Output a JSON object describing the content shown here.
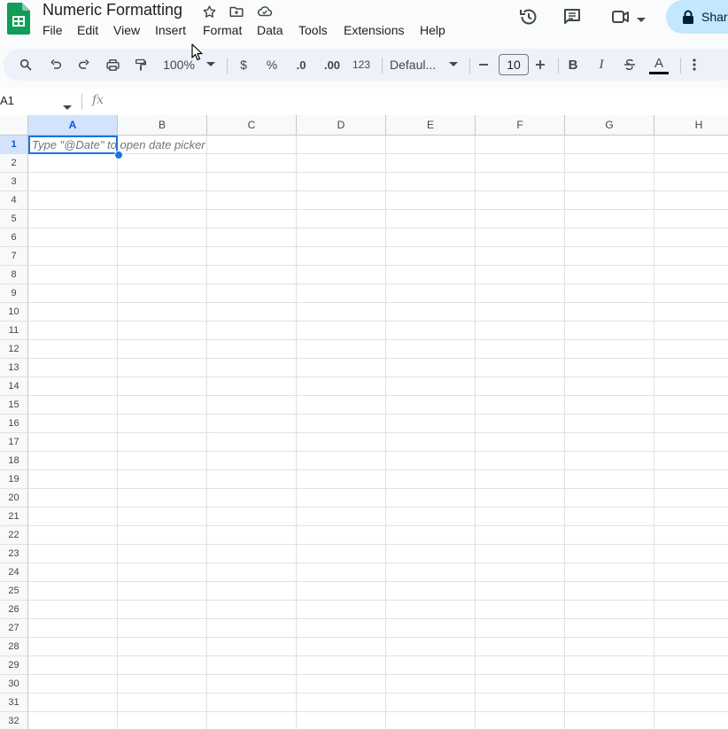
{
  "app": {
    "doc_title": "Numeric Formatting",
    "share_label": "Shar"
  },
  "menu": [
    "File",
    "Edit",
    "View",
    "Insert",
    "Format",
    "Data",
    "Tools",
    "Extensions",
    "Help"
  ],
  "toolbar": {
    "zoom": "100%",
    "currency": "$",
    "percent": "%",
    "decrease_decimal": ".0",
    "increase_decimal": ".00",
    "more_formats": "123",
    "font": "Defaul...",
    "font_size": "10",
    "bold": "B",
    "italic": "I",
    "text_color_letter": "A"
  },
  "formula_bar": {
    "name_box": "A1",
    "fx": "fx"
  },
  "grid": {
    "columns": [
      "A",
      "B",
      "C",
      "D",
      "E",
      "F",
      "G",
      "H"
    ],
    "rows": [
      "1",
      "2",
      "3",
      "4",
      "5",
      "6",
      "7",
      "8",
      "9",
      "10",
      "11",
      "12",
      "13",
      "14",
      "15",
      "16",
      "17",
      "18",
      "19",
      "20",
      "21",
      "22",
      "23",
      "24",
      "25",
      "26",
      "27",
      "28",
      "29",
      "30",
      "31",
      "32"
    ],
    "selected_cell": "A1",
    "cell_hint": "Type \"@Date\" to open date picker"
  },
  "colors": {
    "accent": "#1a73e8",
    "share_bg": "#c2e7ff",
    "sheets_green": "#0f9d58"
  }
}
